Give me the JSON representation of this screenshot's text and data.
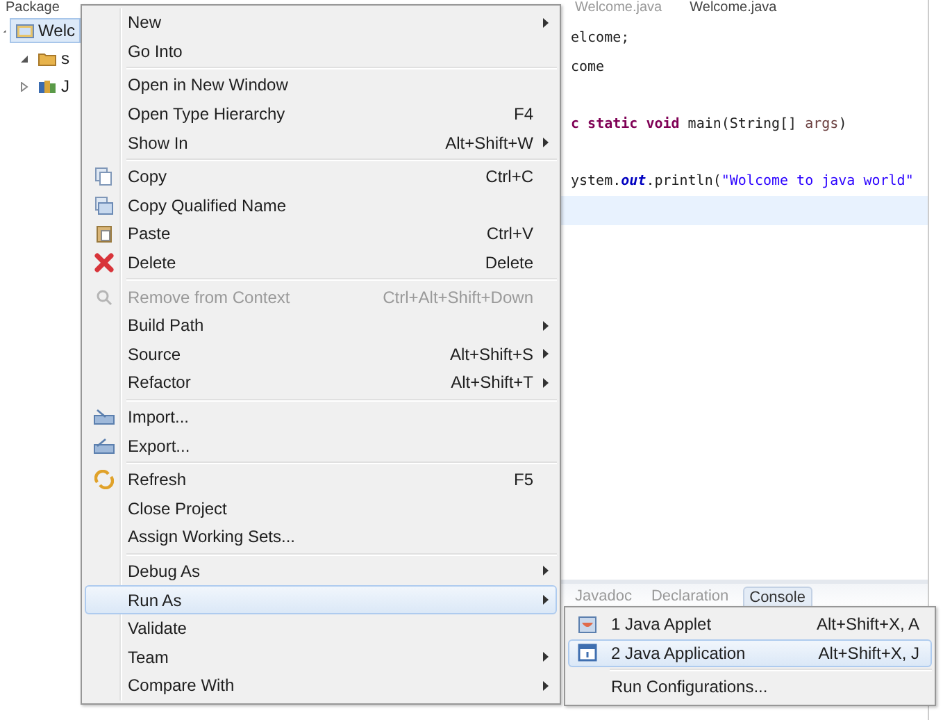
{
  "package_explorer": {
    "title": "Package",
    "tree": [
      {
        "label": "Welc",
        "selected": true,
        "expanded": true,
        "children": [
          {
            "label": "s",
            "selected": false,
            "expanded": true
          },
          {
            "label": "J",
            "selected": false,
            "expanded": false
          }
        ]
      }
    ]
  },
  "editor": {
    "tabs": [
      {
        "label": "Welcome.java",
        "selected": false
      },
      {
        "label": "Welcome.java",
        "selected": true
      }
    ],
    "lines": [
      {
        "blank_before": false,
        "current": false,
        "spans": [
          {
            "text": "elcome;",
            "kind": "plain"
          }
        ]
      },
      {
        "blank_before": false,
        "current": false,
        "spans": [
          {
            "text": "come",
            "kind": "plain"
          }
        ]
      },
      {
        "blank_before": true,
        "current": false,
        "spans": [
          {
            "text": "c ",
            "kind": "keyword"
          },
          {
            "text": "static void",
            "kind": "keyword"
          },
          {
            "text": " main(String[] ",
            "kind": "plain"
          },
          {
            "text": "args",
            "kind": "param"
          },
          {
            "text": ")",
            "kind": "plain"
          }
        ]
      },
      {
        "blank_before": true,
        "current": false,
        "spans": [
          {
            "text": "ystem.",
            "kind": "plain"
          },
          {
            "text": "out",
            "kind": "field"
          },
          {
            "text": ".println(",
            "kind": "plain"
          },
          {
            "text": "\"Wolcome to java world\"",
            "kind": "string"
          }
        ]
      },
      {
        "blank_before": false,
        "current": true
      }
    ]
  },
  "bottom_panel": {
    "tabs": [
      {
        "label": "Javadoc",
        "selected": false
      },
      {
        "label": "Declaration",
        "selected": false
      },
      {
        "label": "Console",
        "selected": true
      }
    ]
  },
  "context_menu": {
    "groups": [
      [
        {
          "label": "New",
          "submenu": true,
          "disabled": false,
          "selected": false
        },
        {
          "label": "Go Into",
          "submenu": false,
          "disabled": false,
          "selected": false
        }
      ],
      [
        {
          "label": "Open in New Window",
          "submenu": false,
          "disabled": false,
          "selected": false
        },
        {
          "label": "Open Type Hierarchy",
          "shortcut": "F4",
          "submenu": false,
          "disabled": false,
          "selected": false
        },
        {
          "label": "Show In",
          "shortcut": "Alt+Shift+W",
          "submenu": true,
          "disabled": false,
          "selected": false
        }
      ],
      [
        {
          "label": "Copy",
          "shortcut": "Ctrl+C",
          "submenu": false,
          "disabled": false,
          "selected": false
        },
        {
          "label": "Copy Qualified Name",
          "submenu": false,
          "disabled": false,
          "selected": false
        },
        {
          "label": "Paste",
          "shortcut": "Ctrl+V",
          "submenu": false,
          "disabled": false,
          "selected": false
        },
        {
          "label": "Delete",
          "shortcut": "Delete",
          "submenu": false,
          "disabled": false,
          "selected": false
        }
      ],
      [
        {
          "label": "Remove from Context",
          "shortcut": "Ctrl+Alt+Shift+Down",
          "submenu": false,
          "disabled": true,
          "selected": false
        },
        {
          "label": "Build Path",
          "submenu": true,
          "disabled": false,
          "selected": false
        },
        {
          "label": "Source",
          "shortcut": "Alt+Shift+S",
          "submenu": true,
          "disabled": false,
          "selected": false
        },
        {
          "label": "Refactor",
          "shortcut": "Alt+Shift+T",
          "submenu": true,
          "disabled": false,
          "selected": false
        }
      ],
      [
        {
          "label": "Import...",
          "submenu": false,
          "disabled": false,
          "selected": false
        },
        {
          "label": "Export...",
          "submenu": false,
          "disabled": false,
          "selected": false
        }
      ],
      [
        {
          "label": "Refresh",
          "shortcut": "F5",
          "submenu": false,
          "disabled": false,
          "selected": false
        },
        {
          "label": "Close Project",
          "submenu": false,
          "disabled": false,
          "selected": false
        },
        {
          "label": "Assign Working Sets...",
          "submenu": false,
          "disabled": false,
          "selected": false
        }
      ],
      [
        {
          "label": "Debug As",
          "submenu": true,
          "disabled": false,
          "selected": false
        },
        {
          "label": "Run As",
          "submenu": true,
          "disabled": false,
          "selected": true
        },
        {
          "label": "Validate",
          "submenu": false,
          "disabled": false,
          "selected": false
        },
        {
          "label": "Team",
          "submenu": true,
          "disabled": false,
          "selected": false
        },
        {
          "label": "Compare With",
          "submenu": true,
          "disabled": false,
          "selected": false
        }
      ]
    ]
  },
  "submenu": {
    "groups": [
      [
        {
          "label": "1 Java Applet",
          "shortcut": "Alt+Shift+X, A",
          "selected": false
        },
        {
          "label": "2 Java Application",
          "shortcut": "Alt+Shift+X, J",
          "selected": true
        }
      ],
      [
        {
          "label": "Run Configurations...",
          "selected": false
        }
      ]
    ]
  }
}
